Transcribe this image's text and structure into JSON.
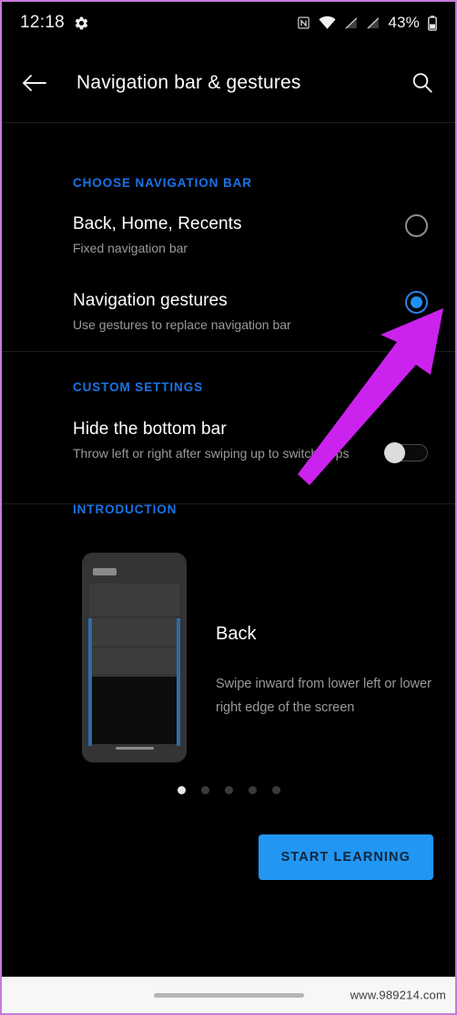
{
  "status_bar": {
    "time": "12:18",
    "icons_left": [
      "gear-icon"
    ],
    "icons_right": [
      "nfc-icon",
      "wifi-icon",
      "signal-off-icon",
      "signal-off-2-icon"
    ],
    "battery_percent": "43%"
  },
  "app_bar": {
    "back_icon": "back-arrow-icon",
    "title": "Navigation bar & gestures",
    "search_icon": "search-icon"
  },
  "sections": {
    "choose_navigation_bar": {
      "header": "CHOOSE NAVIGATION BAR",
      "options": [
        {
          "title": "Back, Home, Recents",
          "subtitle": "Fixed navigation bar",
          "selected": false
        },
        {
          "title": "Navigation gestures",
          "subtitle": "Use gestures to replace navigation bar",
          "selected": true
        }
      ]
    },
    "custom_settings": {
      "header": "CUSTOM SETTINGS",
      "items": [
        {
          "title": "Hide the bottom bar",
          "subtitle": "Throw left or right after swiping up to switch apps",
          "toggle_state": "off"
        }
      ]
    },
    "introduction": {
      "header": "INTRODUCTION",
      "card": {
        "title": "Back",
        "description": "Swipe inward from lower left or lower right edge of the screen"
      },
      "pager": {
        "total": 5,
        "active_index": 0
      },
      "cta_label": "START LEARNING"
    }
  },
  "annotation": {
    "arrow_color": "#cc22ee",
    "points_to": "navigation-gestures-radio"
  },
  "bottom_bar": {
    "watermark": "www.989214.com"
  },
  "colors": {
    "accent_blue": "#1a73e8",
    "cta_blue": "#2196f3",
    "radio_selected": "#1f8ff5",
    "background": "#000000"
  }
}
